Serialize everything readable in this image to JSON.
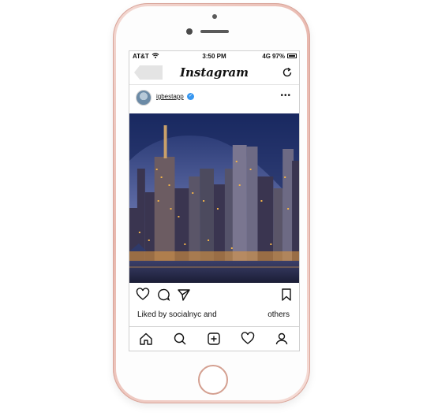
{
  "status_bar": {
    "carrier": "AT&T",
    "time": "3:50 PM",
    "network": "4G",
    "battery": "97%"
  },
  "header": {
    "logo": "Instagram",
    "back_icon": "back-arrow-icon",
    "refresh_icon": "refresh-icon"
  },
  "post": {
    "username": "igbestapp",
    "verified_icon": "verified-badge-icon",
    "more_icon": "more-dots-icon",
    "image_subject": "city-skyline-night-icon",
    "liked_by_prefix": "Liked by",
    "liked_by_user": "socialnyc",
    "liked_by_and": "and",
    "liked_by_others": "others"
  },
  "colors": {
    "phone_body": "#e8b7ad",
    "verified_blue": "#3897f0",
    "sky_top": "#1e2f6a",
    "sky_bottom": "#6b79b0",
    "city_lights": "#f2b34a"
  }
}
